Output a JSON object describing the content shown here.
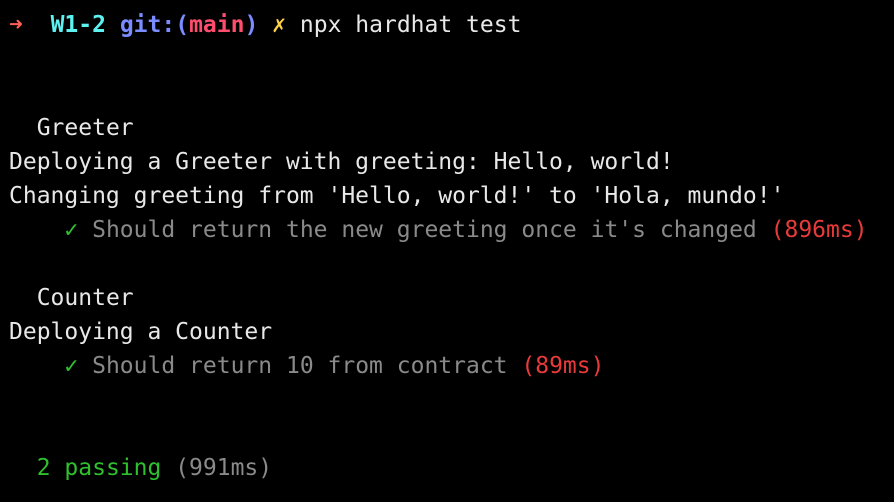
{
  "prompt": {
    "arrow": "➜",
    "dir": "W1-2",
    "git_label": "git:(",
    "branch": "main",
    "git_close": ")",
    "dirty": "✗",
    "command": "npx hardhat test"
  },
  "suites": [
    {
      "title": "Greeter",
      "logs": [
        "Deploying a Greeter with greeting: Hello, world!",
        "Changing greeting from 'Hello, world!' to 'Hola, mundo!'"
      ],
      "test": {
        "check": "✓",
        "name": "Should return the new greeting once it's changed",
        "time": "(896ms)"
      }
    },
    {
      "title": "Counter",
      "logs": [
        "Deploying a Counter"
      ],
      "test": {
        "check": "✓",
        "name": "Should return 10 from contract",
        "time": "(89ms)"
      }
    }
  ],
  "summary": {
    "passing": "2 passing",
    "time": "(991ms)"
  },
  "colors": {
    "background": "#000000",
    "pass": "#2fc02f",
    "slow": "#e83a3a",
    "dim": "#8a8a8a"
  }
}
